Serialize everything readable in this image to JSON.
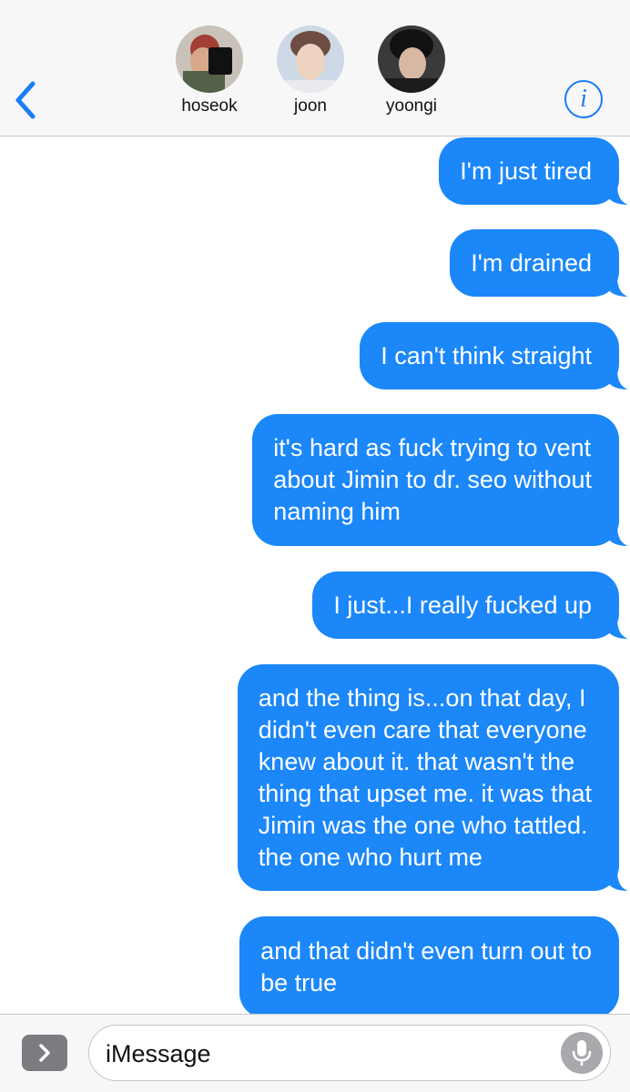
{
  "header": {
    "contacts": [
      {
        "name": "hoseok",
        "avatar_color": "#a34a3c"
      },
      {
        "name": "joon",
        "avatar_color": "#d8b9a6"
      },
      {
        "name": "yoongi",
        "avatar_color": "#2a2a2a"
      }
    ],
    "back_icon": "chevron-left-icon",
    "info_icon": "info-icon",
    "info_label": "i",
    "accent_color": "#1a7df5"
  },
  "messages": [
    {
      "text": "I'm just tired"
    },
    {
      "text": "I'm drained"
    },
    {
      "text": "I can't think straight"
    },
    {
      "text": "it's hard as fuck trying to vent\nabout Jimin to dr. seo without\nnaming him"
    },
    {
      "text": "I just...I really fucked up"
    },
    {
      "text": "and the thing is...on that day, I\ndidn't even care that everyone\nknew about it. that wasn't the\nthing that upset me. it was that\nJimin was the one who tattled.\nthe one who hurt me"
    },
    {
      "text": "and that didn't even turn out to\nbe true"
    }
  ],
  "bubble_color": "#1b87f8",
  "composer": {
    "placeholder": "iMessage",
    "apps_icon": "chevron-right-icon",
    "mic_icon": "microphone-icon"
  }
}
